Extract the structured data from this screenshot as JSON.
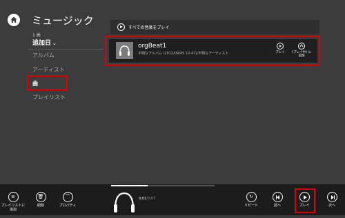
{
  "app": {
    "title": "ミュージック"
  },
  "library": {
    "count_label": "1 曲",
    "sort_label": "追加日",
    "nav": [
      {
        "label": "アルバム",
        "active": false
      },
      {
        "label": "アーティスト",
        "active": false
      },
      {
        "label": "曲",
        "active": true
      },
      {
        "label": "プレイリスト",
        "active": false
      }
    ]
  },
  "main": {
    "play_all_label": "すべての音楽をプレイ",
    "track": {
      "title": "orgBeat1",
      "subtitle": "不明なアルバム (2012/09/05 10:47)/不明なアーティスト",
      "play_label": "プレイ",
      "add_label": "[プレイ中] に追加"
    }
  },
  "player": {
    "left_buttons": {
      "add_to_playlist": "プレイリストに追加",
      "delete": "削除",
      "properties": "プロパティ"
    },
    "time_current": "0:01",
    "time_total": "0:07",
    "progress_fraction": 0.35,
    "right_buttons": {
      "repeat": "リピート",
      "previous": "前へ",
      "play": "プレイ",
      "next": "次へ"
    }
  },
  "colors": {
    "highlight": "#e00000",
    "background": "#3c3c3c",
    "player_bar": "#1c1c1c"
  }
}
